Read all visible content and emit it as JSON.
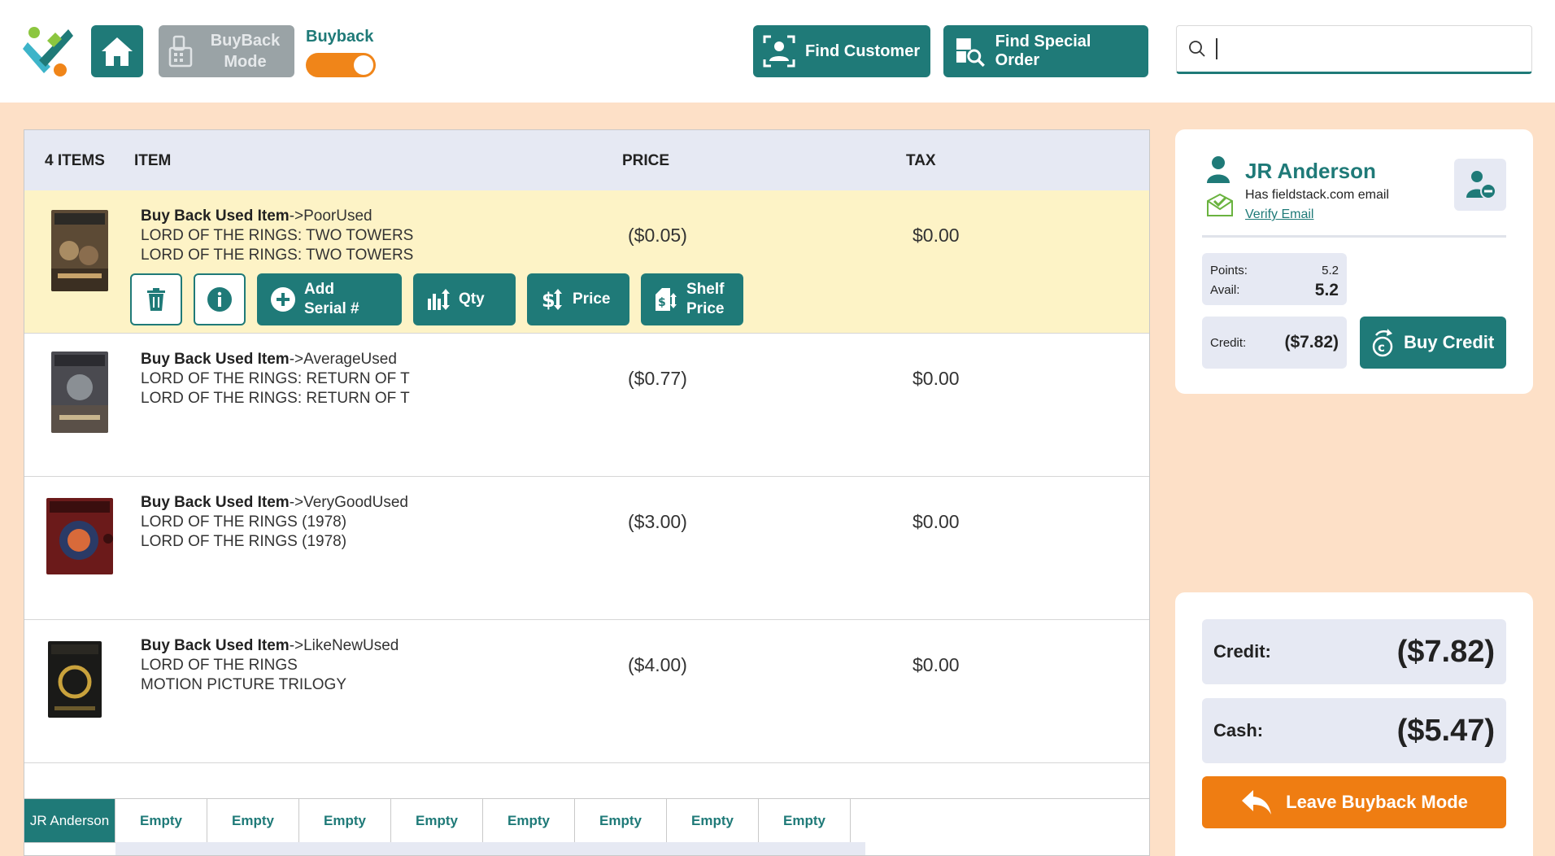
{
  "header": {
    "buyback_mode_label": "BuyBack Mode",
    "buyback_toggle_label": "Buyback",
    "buyback_toggle_on": true,
    "find_customer_label": "Find Customer",
    "find_special_order_label": "Find Special Order",
    "search_value": ""
  },
  "colors": {
    "accent": "#1f7a78",
    "orange": "#ef7d12",
    "background": "#fde0c7",
    "selected_row": "#fdf3c6"
  },
  "table": {
    "count_label": "4 ITEMS",
    "col_item": "ITEM",
    "col_price": "PRICE",
    "col_tax": "TAX",
    "rows": [
      {
        "type": "Buy Back Used Item",
        "condition": "->PoorUsed",
        "line1": "LORD OF THE RINGS: TWO TOWERS",
        "line2": "LORD OF THE RINGS: TWO TOWERS",
        "price": "($0.05)",
        "tax": "$0.00"
      },
      {
        "type": "Buy Back Used Item",
        "condition": "->AverageUsed",
        "line1": "LORD OF THE RINGS: RETURN OF T",
        "line2": "LORD OF THE RINGS: RETURN OF T",
        "price": "($0.77)",
        "tax": "$0.00"
      },
      {
        "type": "Buy Back Used Item",
        "condition": "->VeryGoodUsed",
        "line1": "LORD OF THE RINGS (1978)",
        "line2": "LORD OF THE RINGS (1978)",
        "price": "($3.00)",
        "tax": "$0.00"
      },
      {
        "type": "Buy Back Used Item",
        "condition": "->LikeNewUsed",
        "line1": "LORD OF THE RINGS",
        "line2": "MOTION PICTURE TRILOGY",
        "price": "($4.00)",
        "tax": "$0.00"
      }
    ],
    "actions": {
      "add_serial_line1": "Add",
      "add_serial_line2": "Serial #",
      "qty": "Qty",
      "price": "Price",
      "shelf_line1": "Shelf",
      "shelf_line2": "Price"
    }
  },
  "tabs": [
    "JR Anderson",
    "Empty",
    "Empty",
    "Empty",
    "Empty",
    "Empty",
    "Empty",
    "Empty",
    "Empty"
  ],
  "customer": {
    "name": "JR Anderson",
    "email_note": "Has fieldstack.com email",
    "verify_label": "Verify Email",
    "points_label": "Points:",
    "points_value": "5.2",
    "avail_label": "Avail:",
    "avail_value": "5.2",
    "credit_label": "Credit:",
    "credit_value": "($7.82)",
    "buy_credit_label": "Buy Credit"
  },
  "totals": {
    "credit_label": "Credit:",
    "credit_value": "($7.82)",
    "cash_label": "Cash:",
    "cash_value": "($5.47)",
    "leave_label": "Leave Buyback Mode"
  }
}
